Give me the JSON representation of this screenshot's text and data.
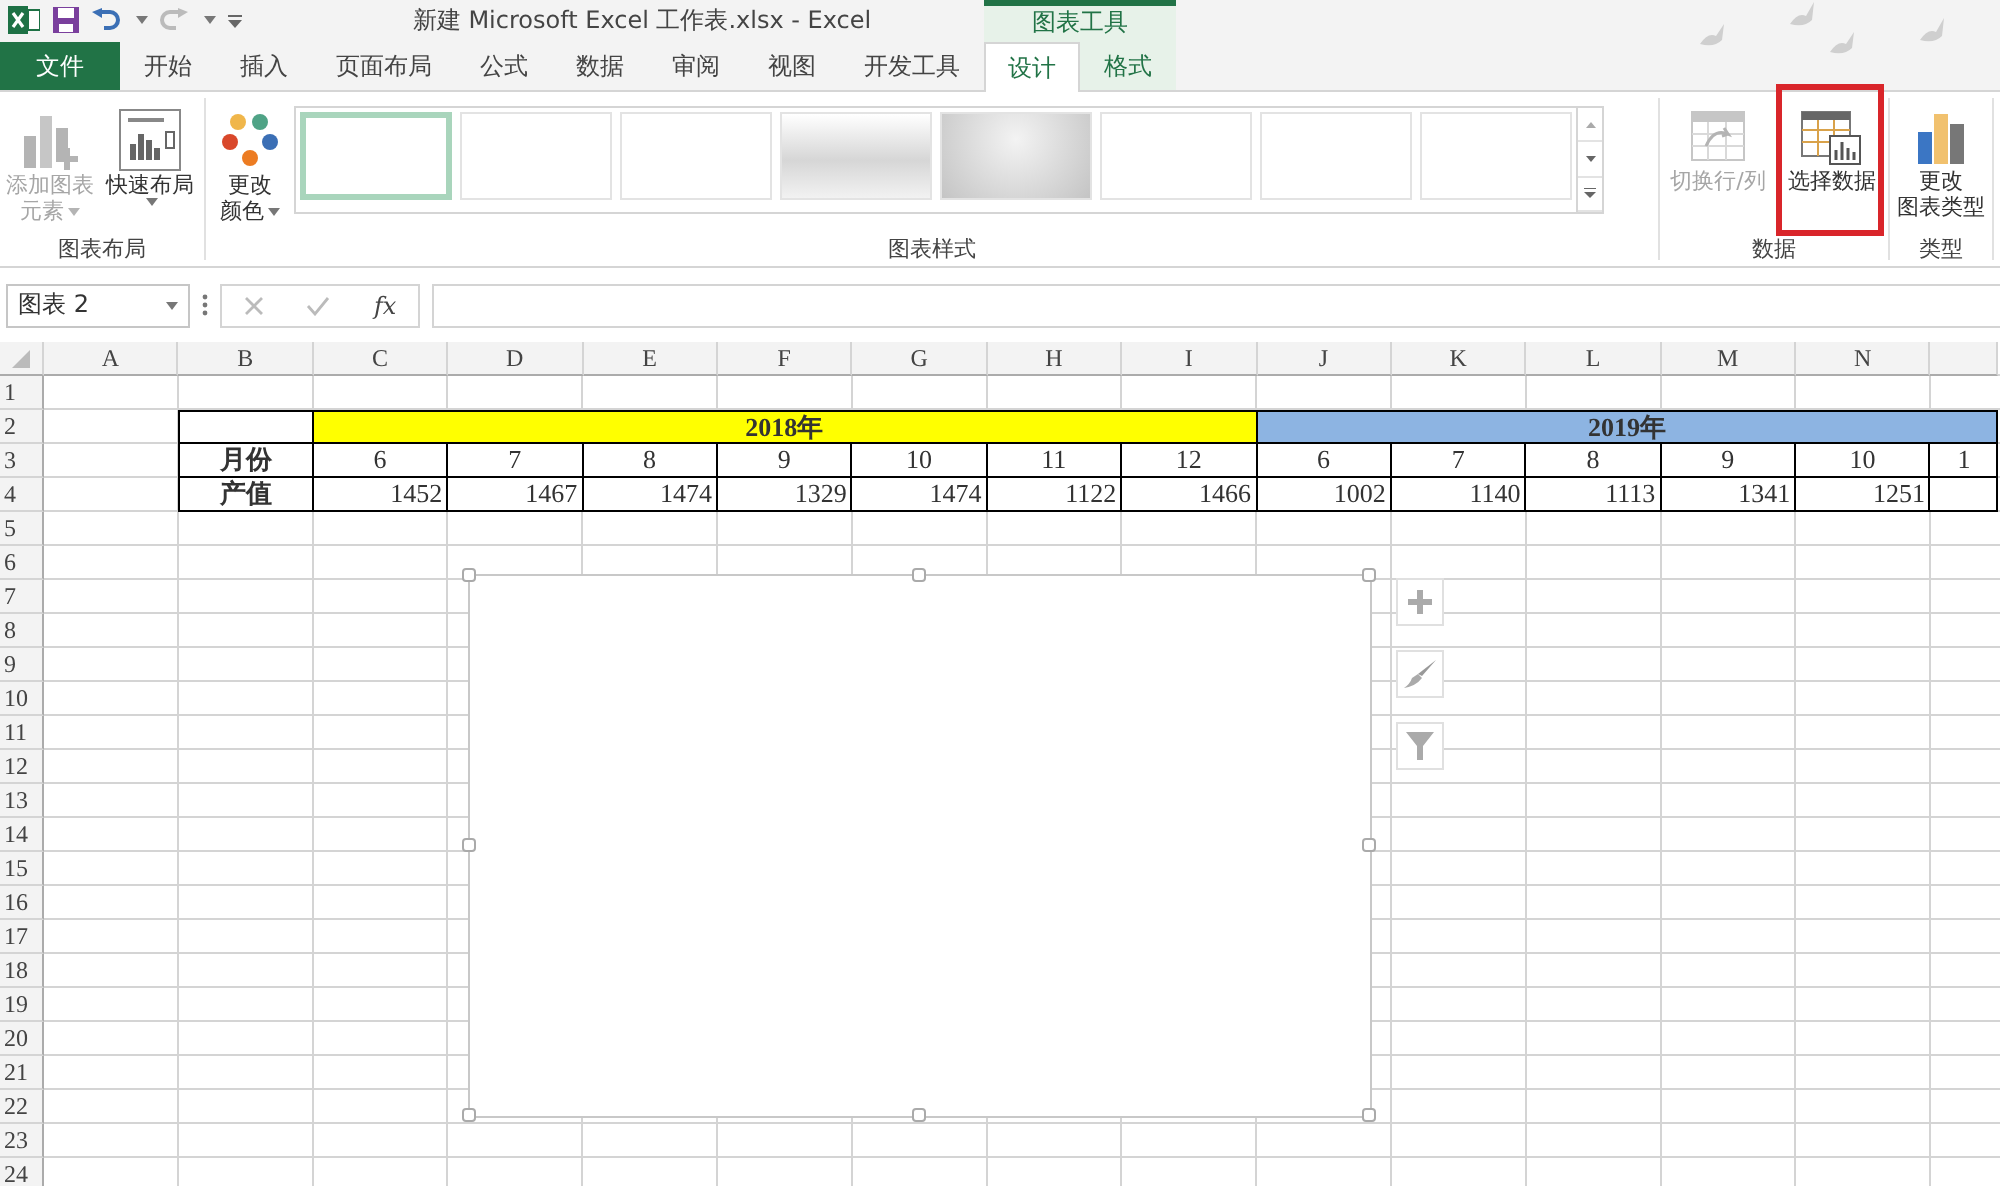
{
  "title_bar": {
    "title": "新建 Microsoft Excel 工作表.xlsx - Excel",
    "context_label": "图表工具"
  },
  "ribbon_tabs": [
    {
      "label": "文件",
      "kind": "file",
      "selected": false
    },
    {
      "label": "开始",
      "kind": "normal",
      "selected": false
    },
    {
      "label": "插入",
      "kind": "normal",
      "selected": false
    },
    {
      "label": "页面布局",
      "kind": "normal",
      "selected": false
    },
    {
      "label": "公式",
      "kind": "normal",
      "selected": false
    },
    {
      "label": "数据",
      "kind": "normal",
      "selected": false
    },
    {
      "label": "审阅",
      "kind": "normal",
      "selected": false
    },
    {
      "label": "视图",
      "kind": "normal",
      "selected": false
    },
    {
      "label": "开发工具",
      "kind": "normal",
      "selected": false
    },
    {
      "label": "设计",
      "kind": "context",
      "selected": true
    },
    {
      "label": "格式",
      "kind": "context",
      "selected": false
    }
  ],
  "ribbon_groups": [
    {
      "label": "图表布局",
      "items": [
        {
          "kind": "add-element",
          "lines": [
            "添加图表",
            "元素"
          ],
          "dropdown": true,
          "disabled": true
        },
        {
          "kind": "quick-layout",
          "lines": [
            "快速布局"
          ],
          "dropdown": true,
          "disabled": false
        }
      ]
    },
    {
      "label": "图表样式",
      "items": [
        {
          "kind": "colors",
          "lines": [
            "更改",
            "颜色"
          ],
          "dropdown": true,
          "disabled": false
        },
        {
          "kind": "gallery",
          "styles": [
            {
              "kind": "plain",
              "selected": true
            },
            {
              "kind": "plain",
              "selected": false
            },
            {
              "kind": "plain",
              "selected": false
            },
            {
              "kind": "shaded",
              "selected": false
            },
            {
              "kind": "dark",
              "selected": false
            },
            {
              "kind": "plain",
              "selected": false
            },
            {
              "kind": "plain",
              "selected": false
            },
            {
              "kind": "plain",
              "selected": false
            }
          ]
        }
      ]
    },
    {
      "label": "数据",
      "items": [
        {
          "kind": "switch-row-column",
          "lines": [
            "切换行/列"
          ],
          "disabled": true
        },
        {
          "kind": "select-data",
          "lines": [
            "选择数据"
          ],
          "disabled": false,
          "highlighted": true
        }
      ]
    },
    {
      "label": "类型",
      "items": [
        {
          "kind": "chart-type",
          "lines": [
            "更改",
            "图表类型"
          ],
          "disabled": false
        }
      ]
    }
  ],
  "formula_bar": {
    "name_box": "图表 2",
    "function_label": "fx"
  },
  "sheet": {
    "columns": [
      "A",
      "B",
      "C",
      "D",
      "E",
      "F",
      "G",
      "H",
      "I",
      "J",
      "K",
      "L",
      "M",
      "N"
    ],
    "row_numbers": [
      "1",
      "2",
      "3",
      "4",
      "5",
      "6",
      "7",
      "8",
      "9",
      "10",
      "11",
      "12",
      "13",
      "14",
      "15",
      "16",
      "17",
      "18",
      "19",
      "20",
      "21",
      "22",
      "23",
      "24"
    ],
    "table": {
      "year_headers": [
        {
          "label": "2018年",
          "color": "#ffff00"
        },
        {
          "label": "2019年",
          "color": "#8db4e2"
        }
      ],
      "rows": [
        {
          "label": "月份",
          "kind": "month",
          "values": [
            "6",
            "7",
            "8",
            "9",
            "10",
            "11",
            "12",
            "6",
            "7",
            "8",
            "9",
            "10",
            "1"
          ]
        },
        {
          "label": "产值",
          "kind": "value",
          "values": [
            "1452",
            "1467",
            "1474",
            "1329",
            "1474",
            "1122",
            "1466",
            "1002",
            "1140",
            "1113",
            "1341",
            "1251"
          ]
        }
      ]
    }
  },
  "chart": {
    "selected": true
  },
  "chart_buttons": [
    {
      "kind": "elements"
    },
    {
      "kind": "styles"
    },
    {
      "kind": "filter"
    }
  ]
}
